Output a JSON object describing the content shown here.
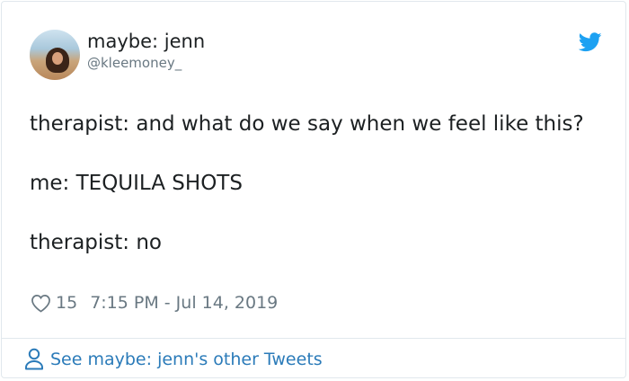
{
  "tweet": {
    "author": {
      "display_name": "maybe: jenn",
      "handle": "@kleemoney_",
      "avatar_icon": "profile-photo"
    },
    "logo_icon": "twitter-bird-icon",
    "text_paragraphs": [
      "therapist: and what do we say when we feel like this?",
      "me: TEQUILA SHOTS",
      "therapist: no"
    ],
    "like_icon": "heart-icon",
    "like_count": "15",
    "timestamp": "7:15 PM - Jul 14, 2019"
  },
  "footer": {
    "icon": "person-icon",
    "link_text": "See maybe: jenn's other Tweets"
  },
  "colors": {
    "text": "#1c2022",
    "secondary": "#697882",
    "link": "#2b7bb9",
    "twitter_blue": "#1da1f2",
    "border": "#e1e8ed"
  }
}
